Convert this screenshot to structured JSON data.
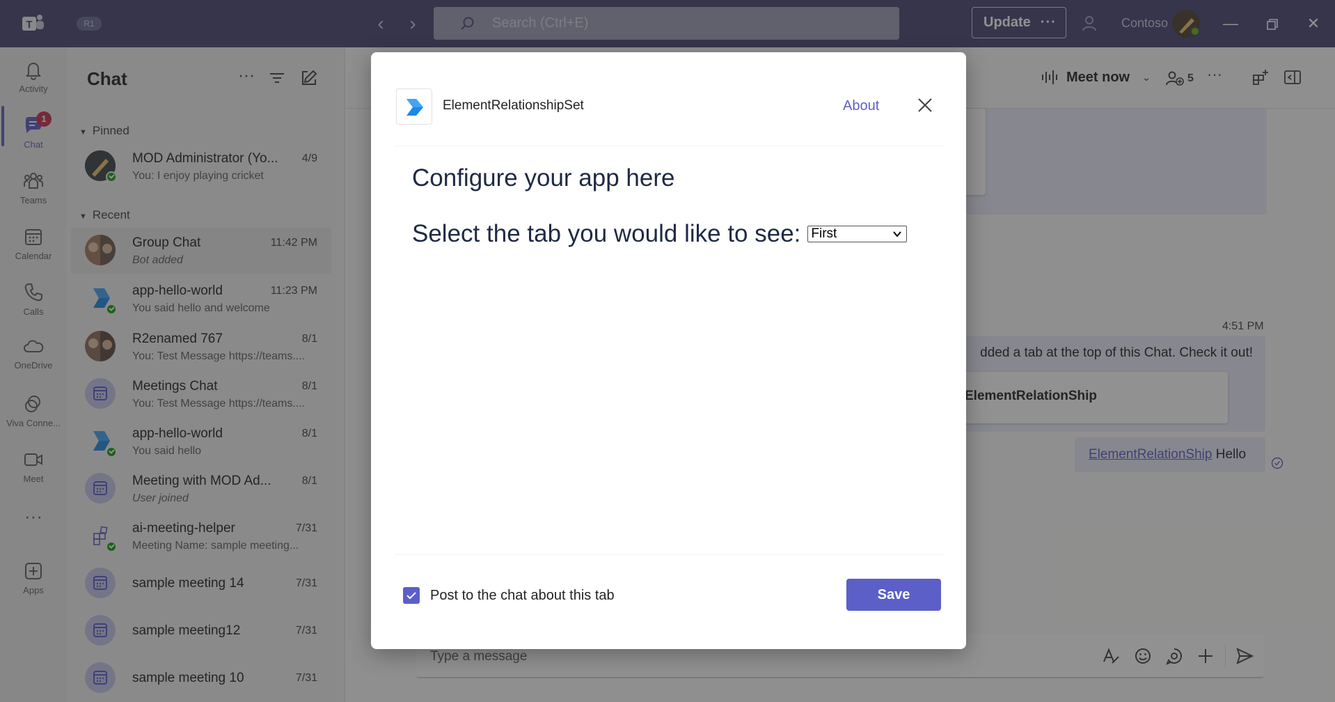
{
  "titlebar": {
    "badge": "R1",
    "search_placeholder": "Search (Ctrl+E)",
    "update_label": "Update",
    "update_more": "···",
    "org": "Contoso"
  },
  "rail": {
    "items": [
      {
        "label": "Activity",
        "icon": "bell-icon"
      },
      {
        "label": "Chat",
        "icon": "chat-icon",
        "badge": "1",
        "active": true
      },
      {
        "label": "Teams",
        "icon": "teams-icon"
      },
      {
        "label": "Calendar",
        "icon": "calendar-icon"
      },
      {
        "label": "Calls",
        "icon": "phone-icon"
      },
      {
        "label": "OneDrive",
        "icon": "cloud-icon"
      },
      {
        "label": "Viva Conne...",
        "icon": "viva-icon"
      },
      {
        "label": "Meet",
        "icon": "video-icon"
      },
      {
        "label": "Apps",
        "icon": "add-app-icon"
      }
    ],
    "more": "···"
  },
  "chatlist": {
    "title": "Chat",
    "pinned_label": "Pinned",
    "recent_label": "Recent",
    "pinned": [
      {
        "name": "MOD Administrator (Yo...",
        "time": "4/9",
        "preview": "You: I enjoy playing cricket"
      }
    ],
    "recent": [
      {
        "name": "Group Chat",
        "time": "11:42 PM",
        "preview": "Bot added",
        "italic": true,
        "avatar": "group"
      },
      {
        "name": "app-hello-world",
        "time": "11:23 PM",
        "preview": "You said hello and welcome",
        "avatar": "app"
      },
      {
        "name": "R2enamed 767",
        "time": "8/1",
        "preview": "You: Test Message https://teams....",
        "avatar": "group"
      },
      {
        "name": "Meetings Chat",
        "time": "8/1",
        "preview": "You: Test Message https://teams....",
        "avatar": "meeting"
      },
      {
        "name": "app-hello-world",
        "time": "8/1",
        "preview": "You said hello",
        "avatar": "app"
      },
      {
        "name": "Meeting with MOD Ad...",
        "time": "8/1",
        "preview": "User joined",
        "italic": true,
        "avatar": "meeting"
      },
      {
        "name": "ai-meeting-helper",
        "time": "7/31",
        "preview": "Meeting Name: sample meeting...",
        "avatar": "appgrid"
      },
      {
        "name": "sample meeting 14",
        "time": "7/31",
        "preview": "",
        "avatar": "meeting"
      },
      {
        "name": "sample meeting12",
        "time": "7/31",
        "preview": "",
        "avatar": "meeting"
      },
      {
        "name": "sample meeting 10",
        "time": "7/31",
        "preview": "",
        "avatar": "meeting"
      }
    ]
  },
  "main": {
    "meet_now": "Meet now",
    "participants": "5",
    "msg_time": "4:51 PM",
    "msg_text": "dded a tab at the top of this Chat. Check it out!",
    "card_title": "ElementRelationShip",
    "sent_link": "ElementRelationShip",
    "sent_text": " Hello",
    "compose_placeholder": "Type a message"
  },
  "dialog": {
    "app_name": "ElementRelationshipSet",
    "about": "About",
    "heading": "Configure your app here",
    "select_prompt": "Select the tab you would like to see:",
    "select_value": "First",
    "checkbox_label": "Post to the chat about this tab",
    "checkbox_checked": true,
    "save_label": "Save"
  },
  "colors": {
    "titlebar": "#464775",
    "accent": "#5b5fc7",
    "app_icon_blue": "#1e88e5"
  }
}
